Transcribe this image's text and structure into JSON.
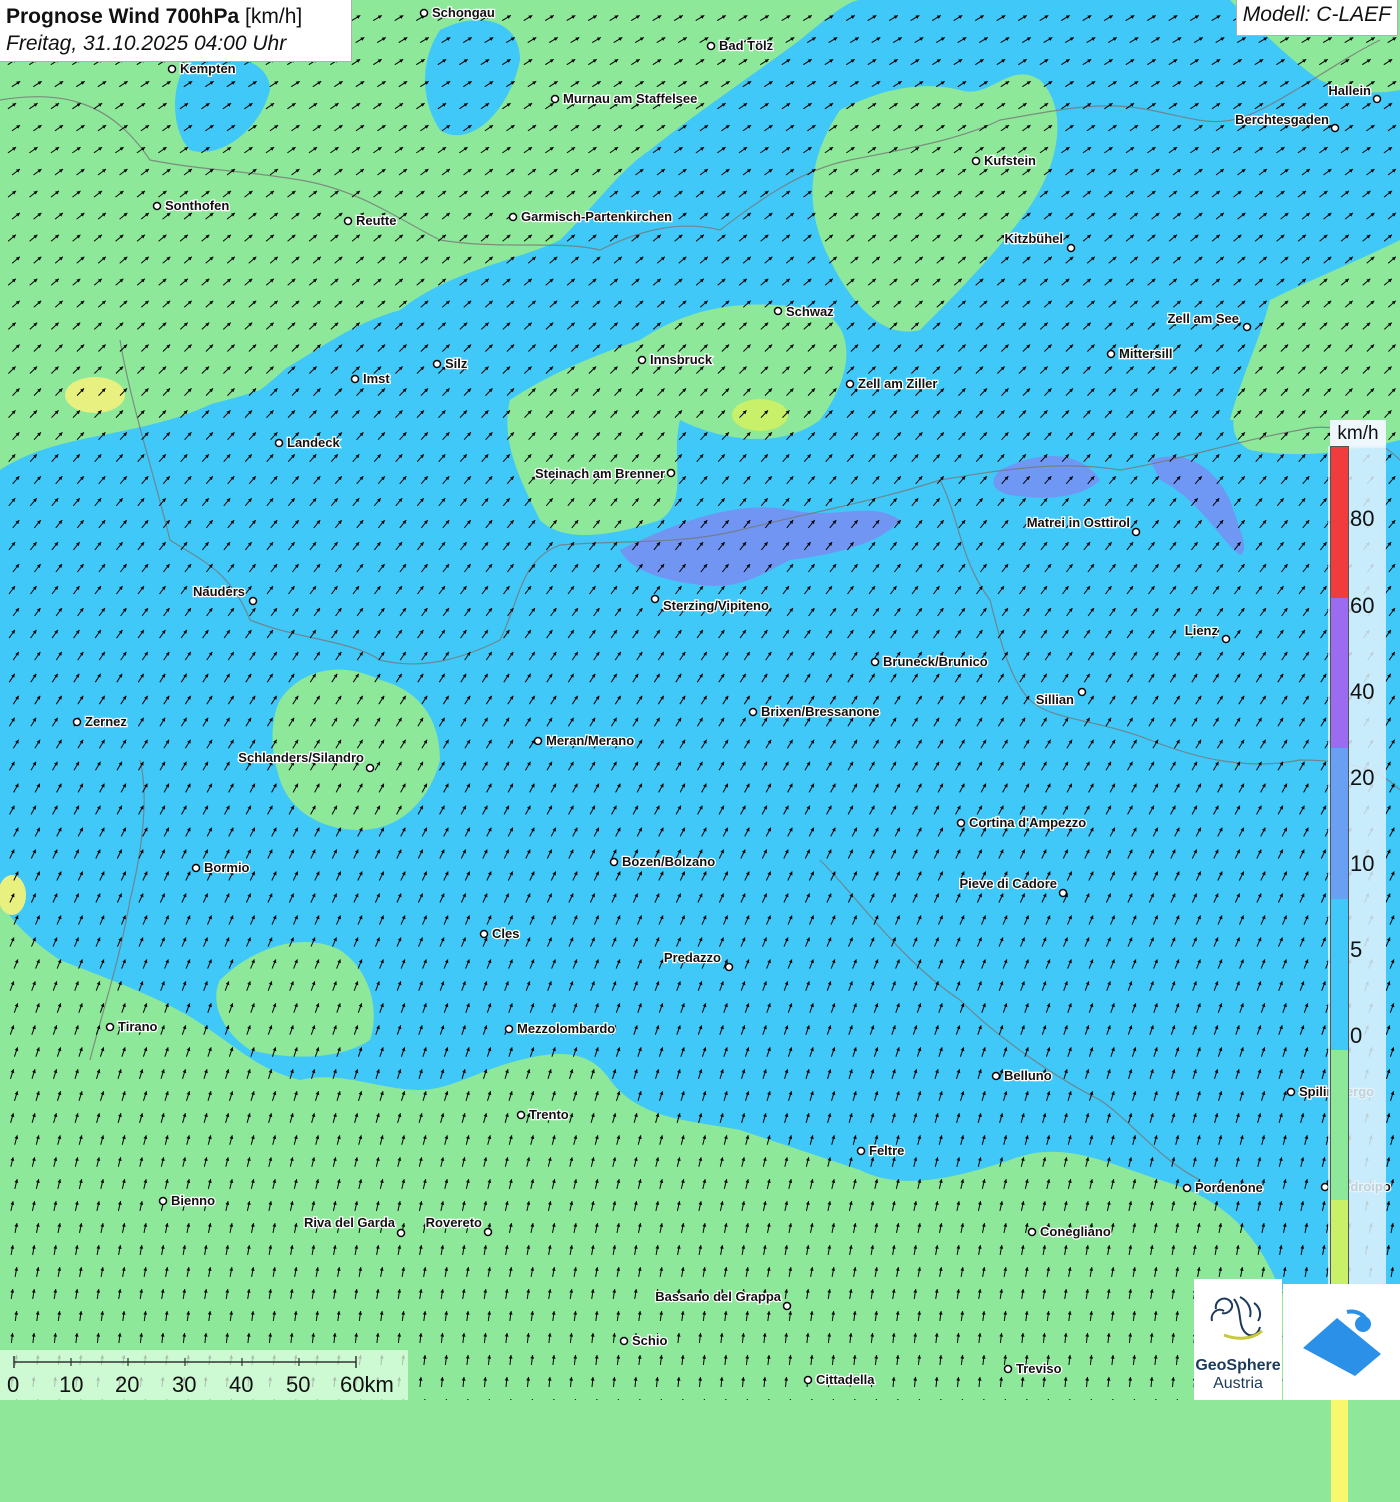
{
  "title": {
    "main": "Prognose Wind 700hPa",
    "unit": "[km/h]",
    "datetime": "Freitag, 31.10.2025 04:00 Uhr"
  },
  "model": "Modell: C-LAEF",
  "legend": {
    "unit": "km/h",
    "labels": [
      "80",
      "60",
      "40",
      "20",
      "10",
      "5",
      "0"
    ],
    "bands": [
      {
        "from": 80,
        "color": "#f03c3c"
      },
      {
        "from": 60,
        "color": "#9b6cf0"
      },
      {
        "from": 40,
        "color": "#6aa0f4"
      },
      {
        "from": 20,
        "color": "#40c8f8"
      },
      {
        "from": 10,
        "color": "#8ee89a"
      },
      {
        "from": 5,
        "color": "#c8f068"
      },
      {
        "from": 0,
        "color": "#f8f870"
      }
    ]
  },
  "scalebar": {
    "labels": [
      "0",
      "10",
      "20",
      "30",
      "40",
      "50",
      "60km"
    ]
  },
  "cities": [
    {
      "name": "Schongau"
    },
    {
      "name": "Bad Tölz"
    },
    {
      "name": "Kempten"
    },
    {
      "name": "Murnau am Staffelsee"
    },
    {
      "name": "Hallein"
    },
    {
      "name": "Berchtesgaden"
    },
    {
      "name": "Kufstein"
    },
    {
      "name": "Sonthofen"
    },
    {
      "name": "Reutte"
    },
    {
      "name": "Garmisch-Partenkirchen"
    },
    {
      "name": "Kitzbühel"
    },
    {
      "name": "Schwaz"
    },
    {
      "name": "Zell am See"
    },
    {
      "name": "Mittersill"
    },
    {
      "name": "Innsbruck"
    },
    {
      "name": "Silz"
    },
    {
      "name": "Imst"
    },
    {
      "name": "Zell am Ziller"
    },
    {
      "name": "Landeck"
    },
    {
      "name": "Steinach am Brenner"
    },
    {
      "name": "Matrei in Osttirol"
    },
    {
      "name": "Nauders"
    },
    {
      "name": "Sterzing/Vipiteno"
    },
    {
      "name": "Lienz"
    },
    {
      "name": "Bruneck/Brunico"
    },
    {
      "name": "Sillian"
    },
    {
      "name": "Zernez"
    },
    {
      "name": "Brixen/Bressanone"
    },
    {
      "name": "Meran/Merano"
    },
    {
      "name": "Schlanders/Silandro"
    },
    {
      "name": "Cortina d'Ampezzo"
    },
    {
      "name": "Bormio"
    },
    {
      "name": "Bozen/Bolzano"
    },
    {
      "name": "Pieve di Cadore"
    },
    {
      "name": "Cles"
    },
    {
      "name": "Predazzo"
    },
    {
      "name": "Tirano"
    },
    {
      "name": "Mezzolombardo"
    },
    {
      "name": "Belluno"
    },
    {
      "name": "Spilimbergo"
    },
    {
      "name": "Trento"
    },
    {
      "name": "Feltre"
    },
    {
      "name": "Pordenone"
    },
    {
      "name": "Codroipo"
    },
    {
      "name": "Bienno"
    },
    {
      "name": "Riva del Garda"
    },
    {
      "name": "Rovereto"
    },
    {
      "name": "Conegliano"
    },
    {
      "name": "Bassano del Grappa"
    },
    {
      "name": "Schio"
    },
    {
      "name": "Treviso"
    },
    {
      "name": "Cittadella"
    }
  ],
  "branding": {
    "geosphere_name": "GeoSphere",
    "geosphere_sub": "Austria"
  },
  "colors": {
    "calm_green": "#8ee89a",
    "wind_blue": "#40c8f8",
    "strong_blue": "#6aa0f4",
    "arrow": "#000000"
  }
}
